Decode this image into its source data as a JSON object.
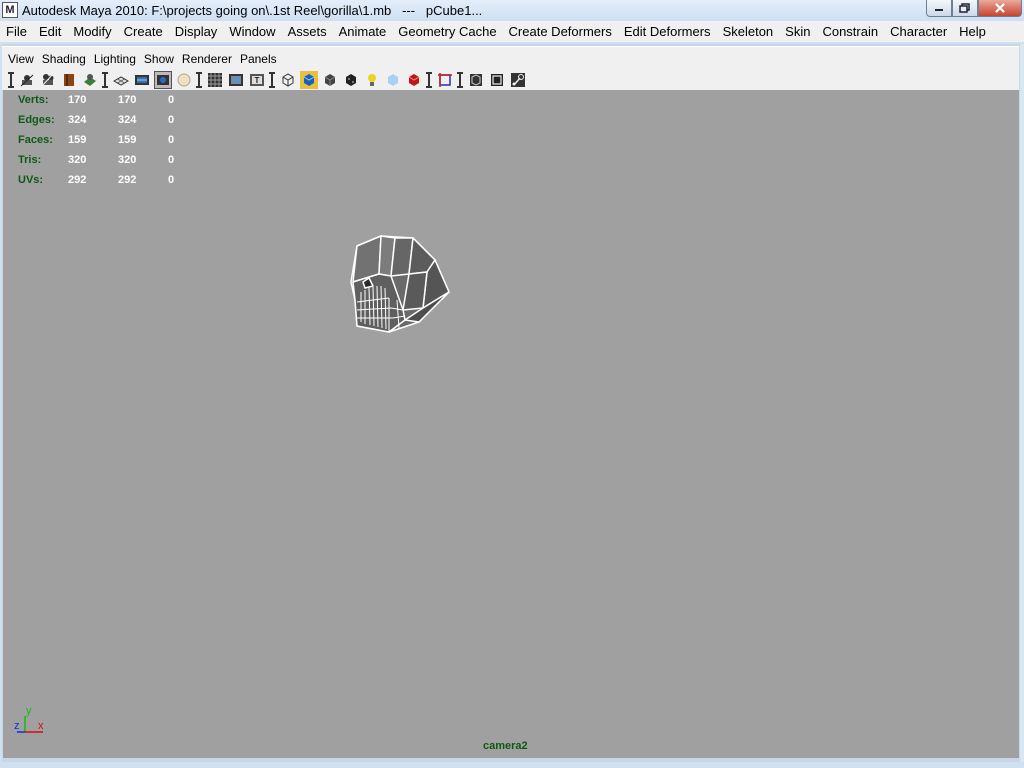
{
  "window": {
    "title": "Autodesk Maya 2010: F:\\projects going on\\.1st Reel\\gorilla\\1.mb   ---   pCube1...",
    "app_icon": "maya-icon",
    "controls": {
      "minimize": "minimize-icon",
      "maximize": "maximize-icon",
      "close": "close-icon"
    }
  },
  "menubar": {
    "items": [
      "File",
      "Edit",
      "Modify",
      "Create",
      "Display",
      "Window",
      "Assets",
      "Animate",
      "Geometry Cache",
      "Create Deformers",
      "Edit Deformers",
      "Skeleton",
      "Skin",
      "Constrain",
      "Character",
      "Help"
    ]
  },
  "panel_menu": {
    "items": [
      "View",
      "Shading",
      "Lighting",
      "Show",
      "Renderer",
      "Panels"
    ]
  },
  "toolbar": {
    "icons": [
      "select-camera-icon",
      "camera-attributes-icon",
      "bookmark-icon",
      "image-plane-icon",
      "grid-icon",
      "film-gate-icon",
      "resolution-gate-icon",
      "gate-mask-icon",
      "field-chart-icon",
      "safe-action-icon",
      "safe-title-icon",
      "wireframe-icon",
      "smooth-shade-icon",
      "shade-default-icon",
      "textured-icon",
      "use-lights-icon",
      "shadows-icon",
      "xray-icon",
      "isolate-select-icon",
      "wireframe-on-shaded-icon",
      "backface-culling-icon",
      "joint-xray-icon"
    ]
  },
  "hud": {
    "rows": [
      {
        "label": "Verts:",
        "v1": "170",
        "v2": "170",
        "v3": "0"
      },
      {
        "label": "Edges:",
        "v1": "324",
        "v2": "324",
        "v3": "0"
      },
      {
        "label": "Faces:",
        "v1": "159",
        "v2": "159",
        "v3": "0"
      },
      {
        "label": "Tris:",
        "v1": "320",
        "v2": "320",
        "v3": "0"
      },
      {
        "label": "UVs:",
        "v1": "292",
        "v2": "292",
        "v3": "0"
      }
    ]
  },
  "viewport": {
    "camera": "camera2",
    "axis": {
      "x": "x",
      "y": "y",
      "z": "z"
    },
    "object": "gorilla-head-mesh"
  },
  "colors": {
    "viewport_bg": "#a0a0a0",
    "hud_label": "#0e5a14",
    "hud_value": "#ffffff",
    "axis_x": "#d01010",
    "axis_y": "#10c010",
    "axis_z": "#1030d0"
  }
}
